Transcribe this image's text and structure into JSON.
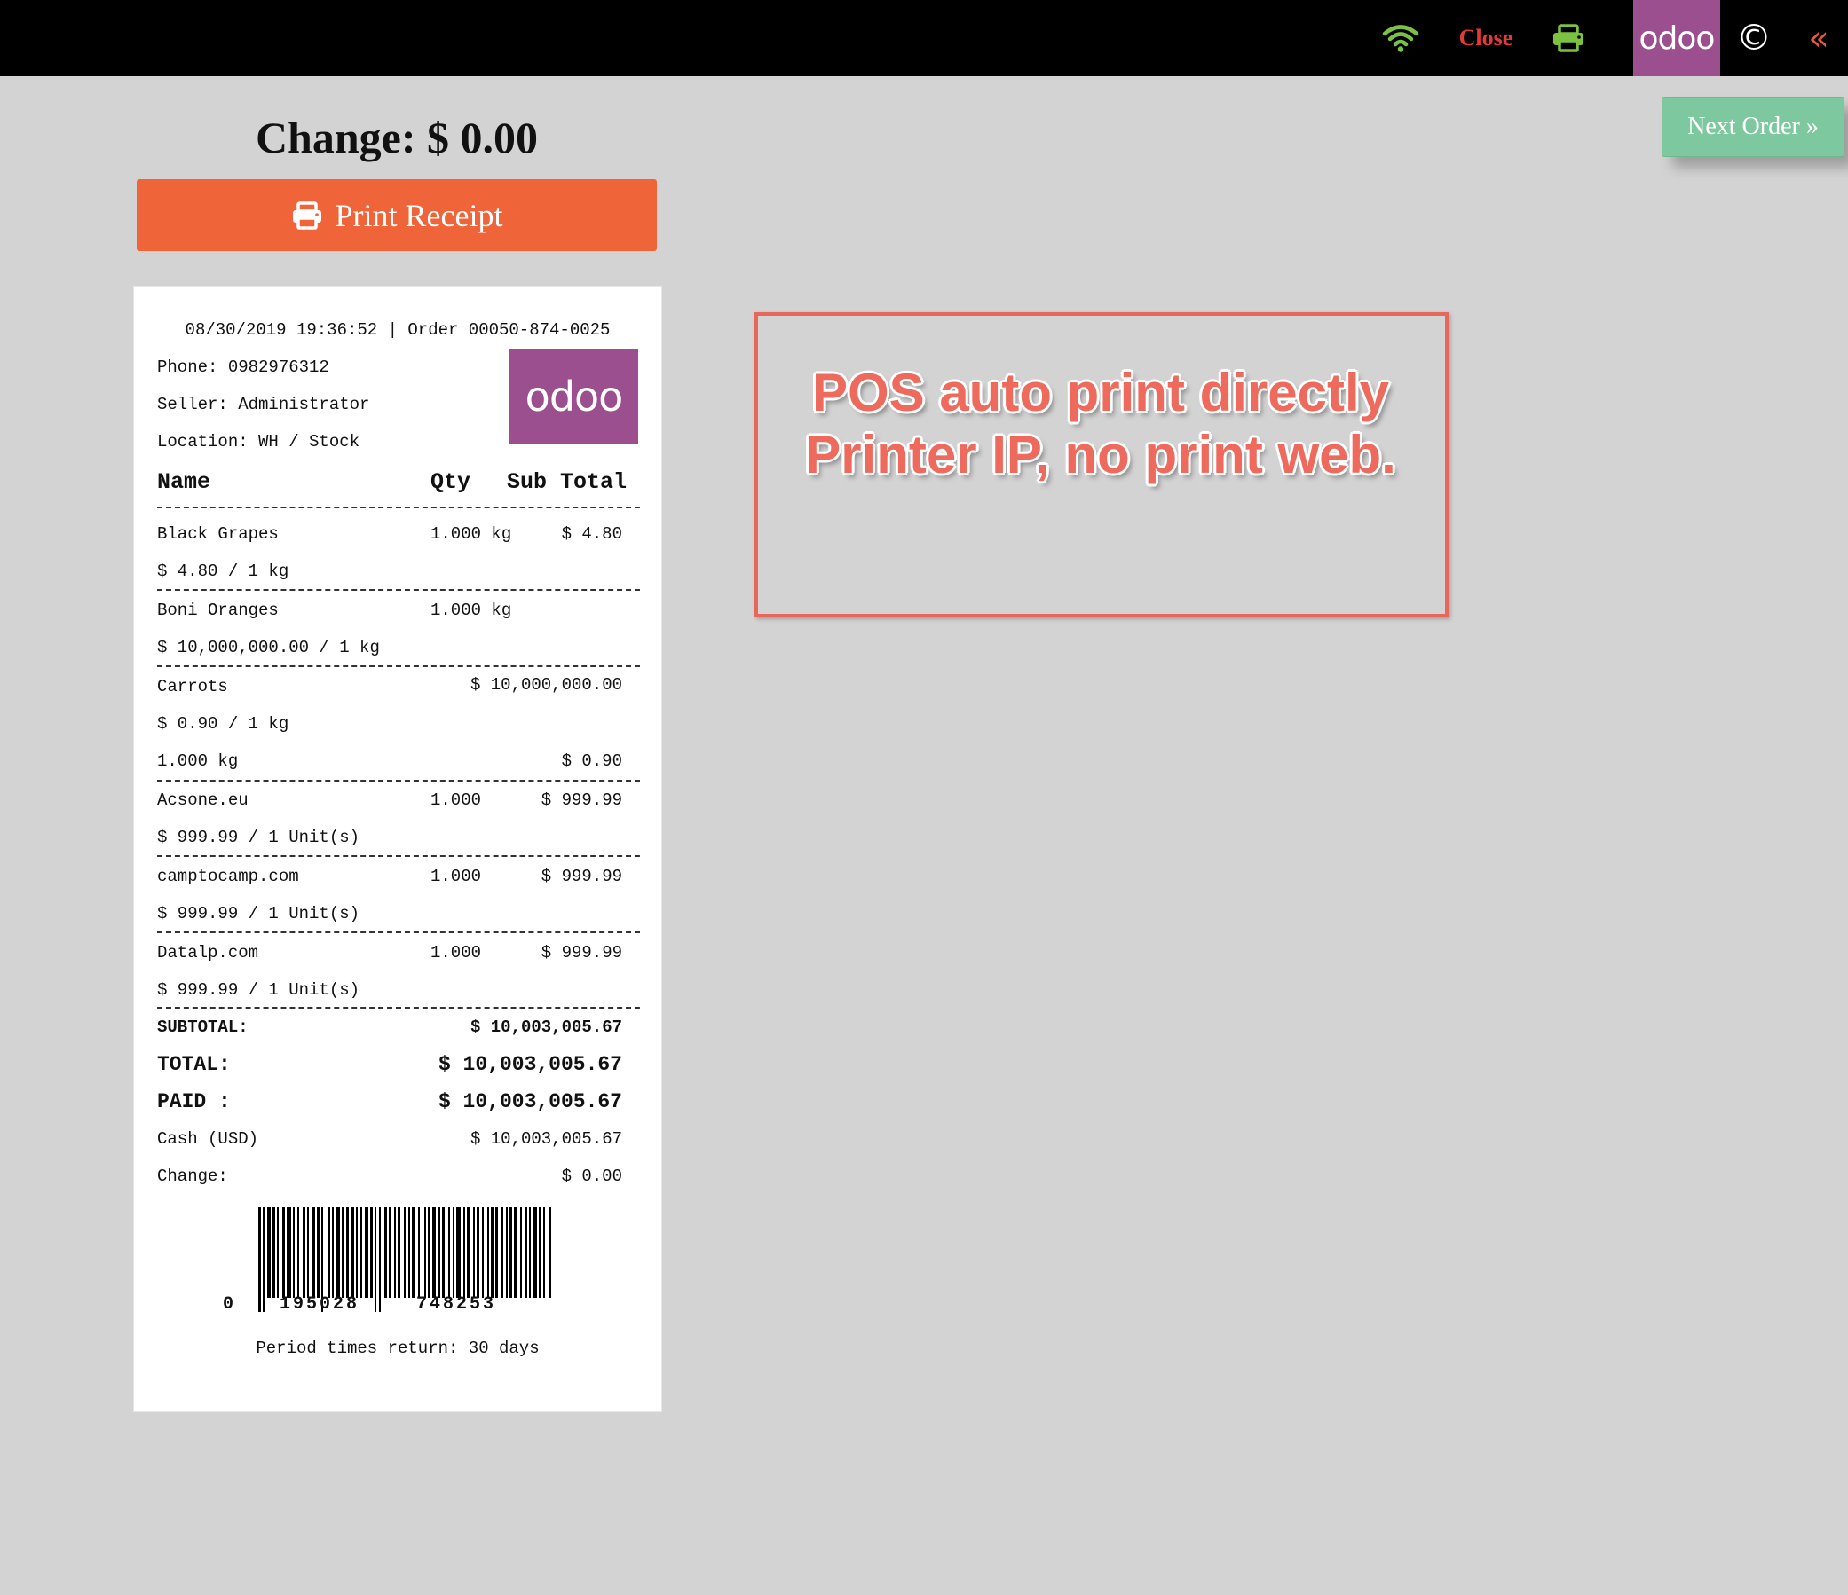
{
  "topbar": {
    "close_label": "Close",
    "logo_text": "odoo",
    "copyright_glyph": "©",
    "back_glyph": "«",
    "icons": [
      "wifi-icon",
      "printer-icon",
      "copyright-icon",
      "double-chevron-left-icon"
    ]
  },
  "next_order": {
    "label": "Next Order »"
  },
  "change": {
    "title": "Change: $ 0.00"
  },
  "print_button": {
    "label": "Print Receipt"
  },
  "receipt": {
    "header": "08/30/2019 19:36:52 | Order 00050-874-0025",
    "phone": "Phone: 0982976312",
    "seller": "Seller: Administrator",
    "location": "Location: WH / Stock",
    "logo_text": "odoo",
    "columns": {
      "name": "Name",
      "qty": "Qty",
      "subtotal": "Sub Total"
    },
    "lines": [
      {
        "name": "Black Grapes",
        "qty": "1.000 kg",
        "total": "$ 4.80",
        "unit": "$ 4.80 / 1 kg"
      },
      {
        "name": "Boni Oranges",
        "qty": "1.000 kg",
        "total": "",
        "unit": "$ 10,000,000.00 / 1 kg"
      },
      {
        "name": "Carrots",
        "qty": "",
        "total": "$ 10,000,000.00",
        "unit": "$ 0.90 / 1 kg",
        "extra_qty": "1.000 kg",
        "extra_total": "$ 0.90"
      },
      {
        "name": "Acsone.eu",
        "qty": "1.000",
        "total": "$ 999.99",
        "unit": "$ 999.99 / 1 Unit(s)"
      },
      {
        "name": "camptocamp.com",
        "qty": "1.000",
        "total": "$ 999.99",
        "unit": "$ 999.99 / 1 Unit(s)"
      },
      {
        "name": "Datalp.com",
        "qty": "1.000",
        "total": "$ 999.99",
        "unit": "$ 999.99 / 1 Unit(s)"
      }
    ],
    "subtotal_label": "SUBTOTAL:",
    "subtotal_value": "$ 10,003,005.67",
    "total_label": "TOTAL:",
    "total_value": "$ 10,003,005.67",
    "paid_label": "PAID :",
    "paid_value": "$ 10,003,005.67",
    "cash_label": "Cash (USD)",
    "cash_value": "$ 10,003,005.67",
    "change_label": "Change:",
    "change_value": "$ 0.00",
    "barcode_digits": [
      "0",
      "195028",
      "748253"
    ],
    "footer": "Period times return: 30 days"
  },
  "annotation": {
    "text": "POS auto print directly Printer IP, no print web.",
    "color": "#ee6a5c"
  },
  "colors": {
    "accent_orange": "#f0643a",
    "odoo_purple": "#9b4f8e",
    "next_order_green": "#7ec8a0",
    "close_red": "#e53935",
    "icon_green": "#7cc242"
  }
}
